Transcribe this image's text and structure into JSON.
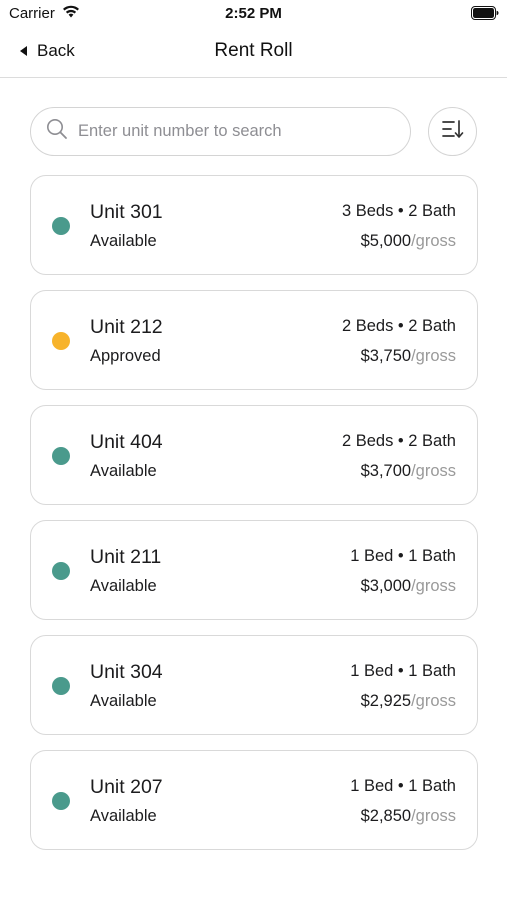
{
  "status_bar": {
    "carrier": "Carrier",
    "time": "2:52 PM"
  },
  "nav": {
    "back_label": "Back",
    "title": "Rent Roll"
  },
  "search": {
    "placeholder": "Enter unit number to search",
    "value": ""
  },
  "colors": {
    "available": "#4a9a8c",
    "approved": "#f7b32b"
  },
  "icons": {
    "search": "search-icon",
    "sort": "sort-icon",
    "back": "chevron-left-icon"
  },
  "units": [
    {
      "name": "Unit 301",
      "status": "Available",
      "status_color": "#4a9a8c",
      "beds": "3 Beds • 2 Bath",
      "price": "$5,000",
      "price_suffix": "/gross"
    },
    {
      "name": "Unit 212",
      "status": "Approved",
      "status_color": "#f7b32b",
      "beds": "2 Beds • 2 Bath",
      "price": "$3,750",
      "price_suffix": "/gross"
    },
    {
      "name": "Unit 404",
      "status": "Available",
      "status_color": "#4a9a8c",
      "beds": "2 Beds • 2 Bath",
      "price": "$3,700",
      "price_suffix": "/gross"
    },
    {
      "name": "Unit 211",
      "status": "Available",
      "status_color": "#4a9a8c",
      "beds": "1 Bed • 1 Bath",
      "price": "$3,000",
      "price_suffix": "/gross"
    },
    {
      "name": "Unit 304",
      "status": "Available",
      "status_color": "#4a9a8c",
      "beds": "1 Bed • 1 Bath",
      "price": "$2,925",
      "price_suffix": "/gross"
    },
    {
      "name": "Unit 207",
      "status": "Available",
      "status_color": "#4a9a8c",
      "beds": "1 Bed • 1 Bath",
      "price": "$2,850",
      "price_suffix": "/gross"
    }
  ]
}
